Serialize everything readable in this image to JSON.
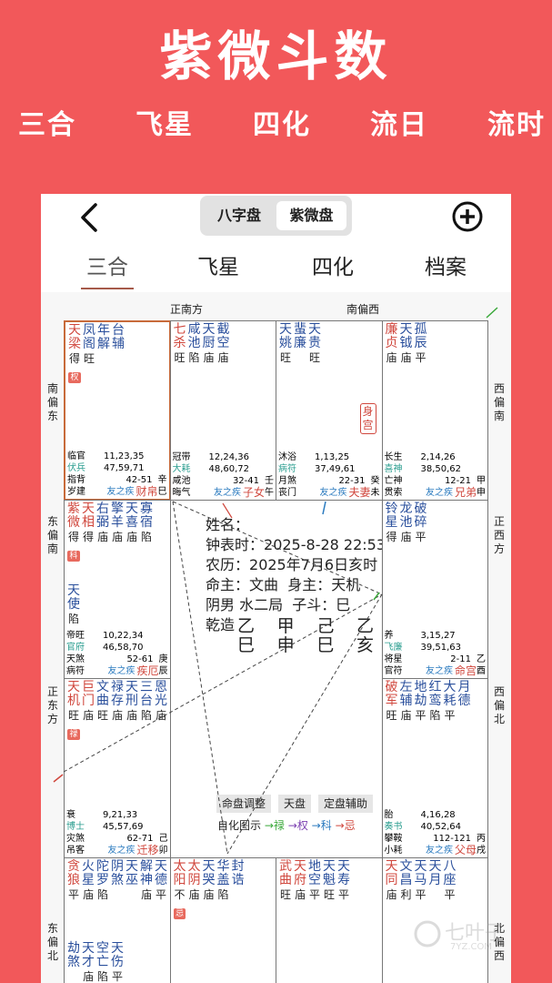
{
  "banner": {
    "title": "紫微斗数",
    "subtitles": [
      "三合",
      "飞星",
      "四化",
      "流日",
      "流时"
    ]
  },
  "topbar": {
    "seg_bazi": "八字盘",
    "seg_ziwei": "紫微盘"
  },
  "tabs": [
    "三合",
    "飞星",
    "四化",
    "档案"
  ],
  "directions": {
    "top_left": "正南方",
    "top_right": "南偏西",
    "left": [
      "南偏东",
      "东偏南",
      "正东方",
      "东偏北"
    ],
    "right": [
      "西偏南",
      "正西方",
      "西偏北",
      "北偏西"
    ]
  },
  "center": {
    "name": "姓名：",
    "clock": "钟表时：",
    "clock_value": "2025-8-28 22:53",
    "lunar": "农历：",
    "lunar_value": "2025年7月6日亥时",
    "ming": "命主：文曲",
    "shen": "身主：天机",
    "gender_ju": "阴男 水二局",
    "zidou": "子斗：巳",
    "qianzao": "乾造",
    "stems": [
      "乙",
      "甲",
      "己",
      "乙"
    ],
    "branches": [
      "巳",
      "申",
      "巳",
      "亥"
    ],
    "buttons": [
      "命盘调整",
      "天盘",
      "定盘辅助"
    ],
    "legend": {
      "label": "自化图示",
      "lu": "禄",
      "quan": "权",
      "ke": "科",
      "ji": "忌"
    }
  },
  "palaces": [
    {
      "id": "si",
      "stars": [
        [
          "天",
          "梁",
          "得"
        ],
        [
          "凤",
          "阁",
          "旺"
        ],
        [
          "年",
          "解",
          ""
        ],
        [
          "台",
          "辅",
          ""
        ]
      ],
      "colors": [
        "#d0473d",
        "#2a4f9c",
        "#2a4f9c",
        "#2a4f9c"
      ],
      "mutag": "权",
      "rows": [
        [
          "临官",
          "11,23,35"
        ],
        [
          "伏兵",
          "47,59,71"
        ],
        [
          "指背",
          "42-51",
          "辛"
        ],
        [
          "岁建",
          "友之疾",
          "财帛",
          "巳"
        ]
      ]
    },
    {
      "id": "wu",
      "stars": [
        [
          "七",
          "杀",
          "旺"
        ],
        [
          "咸",
          "池",
          "陷"
        ],
        [
          "天",
          "厨",
          "庙"
        ],
        [
          "截",
          "空",
          "庙"
        ]
      ],
      "colors": [
        "#d0473d",
        "#2a4f9c",
        "#2a4f9c",
        "#2a4f9c"
      ],
      "rows": [
        [
          "冠带",
          "12,24,36"
        ],
        [
          "大耗",
          "48,60,72"
        ],
        [
          "咸池",
          "32-41",
          "壬"
        ],
        [
          "晦气",
          "友之疾",
          "子女",
          "午"
        ]
      ]
    },
    {
      "id": "wei",
      "stars": [
        [
          "天",
          "姚",
          "旺"
        ],
        [
          "蜚",
          "廉",
          ""
        ],
        [
          "天",
          "贵",
          "旺"
        ]
      ],
      "colors": [
        "#2a4f9c",
        "#2a4f9c",
        "#2a4f9c"
      ],
      "body": "身宫",
      "rows": [
        [
          "沐浴",
          "1,13,25"
        ],
        [
          "病符",
          "37,49,61"
        ],
        [
          "月煞",
          "22-31",
          "癸"
        ],
        [
          "丧门",
          "友之疾",
          "夫妻",
          "未"
        ]
      ]
    },
    {
      "id": "shen",
      "stars": [
        [
          "廉",
          "贞",
          "庙"
        ],
        [
          "天",
          "钺",
          "庙"
        ],
        [
          "孤",
          "辰",
          "平"
        ]
      ],
      "colors": [
        "#d0473d",
        "#2a4f9c",
        "#2a4f9c"
      ],
      "rows": [
        [
          "长生",
          "2,14,26"
        ],
        [
          "喜神",
          "38,50,62"
        ],
        [
          "亡神",
          "12-21",
          "甲"
        ],
        [
          "贯索",
          "友之疾",
          "兄弟",
          "申"
        ]
      ]
    },
    {
      "id": "chen",
      "stars": [
        [
          "紫",
          "微",
          "得"
        ],
        [
          "天",
          "相",
          "得"
        ],
        [
          "右",
          "弼",
          "庙"
        ],
        [
          "擎",
          "羊",
          "庙"
        ],
        [
          "天",
          "喜",
          "庙"
        ],
        [
          "寡",
          "宿",
          "陷"
        ]
      ],
      "colors": [
        "#d0473d",
        "#d0473d",
        "#2a4f9c",
        "#2a4f9c",
        "#2a4f9c",
        "#2a4f9c"
      ],
      "mutag": "科",
      "rows2": [
        [
          "天",
          "使",
          "陷"
        ]
      ],
      "rows": [
        [
          "帝旺",
          "10,22,34"
        ],
        [
          "官府",
          "46,58,70"
        ],
        [
          "天煞",
          "52-61",
          "庚"
        ],
        [
          "病符",
          "友之疾",
          "疾厄",
          "辰"
        ]
      ]
    },
    {
      "id": "you",
      "stars": [
        [
          "铃",
          "星",
          "得"
        ],
        [
          "龙",
          "池",
          "庙"
        ],
        [
          "破",
          "碎",
          "平"
        ]
      ],
      "colors": [
        "#2a4f9c",
        "#2a4f9c",
        "#2a4f9c"
      ],
      "rows": [
        [
          "养",
          "3,15,27"
        ],
        [
          "飞廉",
          "39,51,63"
        ],
        [
          "将星",
          "2-11",
          "乙"
        ],
        [
          "官符",
          "友之疾",
          "命宫",
          "酉"
        ]
      ]
    },
    {
      "id": "mao",
      "stars": [
        [
          "天",
          "机",
          "旺"
        ],
        [
          "巨",
          "门",
          "庙"
        ],
        [
          "文",
          "曲",
          "旺"
        ],
        [
          "禄",
          "存",
          "庙"
        ],
        [
          "天",
          "刑",
          "庙"
        ],
        [
          "三",
          "台",
          "陷"
        ],
        [
          "恩",
          "光",
          "庙"
        ]
      ],
      "colors": [
        "#d0473d",
        "#d0473d",
        "#2a4f9c",
        "#2a4f9c",
        "#2a4f9c",
        "#2a4f9c",
        "#2a4f9c"
      ],
      "mutag": "禄",
      "rows": [
        [
          "衰",
          "9,21,33"
        ],
        [
          "博士",
          "45,57,69"
        ],
        [
          "灾煞",
          "62-71",
          "己"
        ],
        [
          "吊客",
          "友之疾",
          "迁移",
          "卯"
        ]
      ]
    },
    {
      "id": "xu",
      "stars": [
        [
          "破",
          "军",
          "旺"
        ],
        [
          "左",
          "辅",
          "庙"
        ],
        [
          "地",
          "劫",
          "平"
        ],
        [
          "红",
          "鸾",
          "陷"
        ],
        [
          "大",
          "耗",
          "平"
        ],
        [
          "月",
          "德",
          ""
        ]
      ],
      "colors": [
        "#d0473d",
        "#2a4f9c",
        "#2a4f9c",
        "#2a4f9c",
        "#2a4f9c",
        "#2a4f9c"
      ],
      "rows": [
        [
          "胎",
          "4,16,28"
        ],
        [
          "奏书",
          "40,52,64"
        ],
        [
          "攀鞍",
          "112-121",
          "丙"
        ],
        [
          "小耗",
          "友之疾",
          "父母",
          "戌"
        ]
      ]
    },
    {
      "id": "yin",
      "stars": [
        [
          "贪",
          "狼",
          "平"
        ],
        [
          "火",
          "星",
          "庙"
        ],
        [
          "陀",
          "罗",
          "陷"
        ],
        [
          "阴",
          "煞",
          ""
        ],
        [
          "天",
          "巫",
          ""
        ],
        [
          "解",
          "神",
          "庙"
        ],
        [
          "天",
          "德",
          "平"
        ]
      ],
      "colors": [
        "#d0473d",
        "#2a4f9c",
        "#2a4f9c",
        "#2a4f9c",
        "#2a4f9c",
        "#2a4f9c",
        "#2a4f9c"
      ],
      "rows2": [
        [
          "劫",
          "煞",
          ""
        ],
        [
          "天",
          "才",
          "庙"
        ],
        [
          "空",
          "亡",
          "陷"
        ],
        [
          "天",
          "伤",
          "平"
        ]
      ]
    },
    {
      "id": "chou",
      "stars": [
        [
          "太",
          "阳",
          "不"
        ],
        [
          "太",
          "阴",
          "庙"
        ],
        [
          "天",
          "哭",
          "庙"
        ],
        [
          "华",
          "盖",
          "陷"
        ],
        [
          "封",
          "诰",
          ""
        ]
      ],
      "colors": [
        "#d0473d",
        "#d0473d",
        "#2a4f9c",
        "#2a4f9c",
        "#2a4f9c"
      ],
      "mutag": "忌"
    },
    {
      "id": "zi",
      "stars": [
        [
          "武",
          "曲",
          "旺"
        ],
        [
          "天",
          "府",
          "庙"
        ],
        [
          "地",
          "空",
          "平"
        ],
        [
          "天",
          "魁",
          "旺"
        ],
        [
          "天",
          "寿",
          "平"
        ]
      ],
      "colors": [
        "#d0473d",
        "#d0473d",
        "#2a4f9c",
        "#2a4f9c",
        "#2a4f9c"
      ]
    },
    {
      "id": "hai",
      "stars": [
        [
          "天",
          "同",
          "庙"
        ],
        [
          "文",
          "昌",
          "利"
        ],
        [
          "天",
          "马",
          "平"
        ],
        [
          "天",
          "月",
          ""
        ],
        [
          "八",
          "座",
          "平"
        ]
      ],
      "colors": [
        "#d0473d",
        "#2a4f9c",
        "#2a4f9c",
        "#2a4f9c",
        "#2a4f9c"
      ]
    }
  ],
  "watermark": {
    "text": "七叶子",
    "sub": "7YZ.COM"
  },
  "colors": {
    "banner": "#f2585a",
    "star_main": "#d0473d",
    "star_minor": "#2a4f9c",
    "teal": "#2a9d8f",
    "lu": "#3aa83a",
    "quan": "#7b3fb0",
    "ke": "#2a7abf",
    "ji": "#d0473d"
  }
}
